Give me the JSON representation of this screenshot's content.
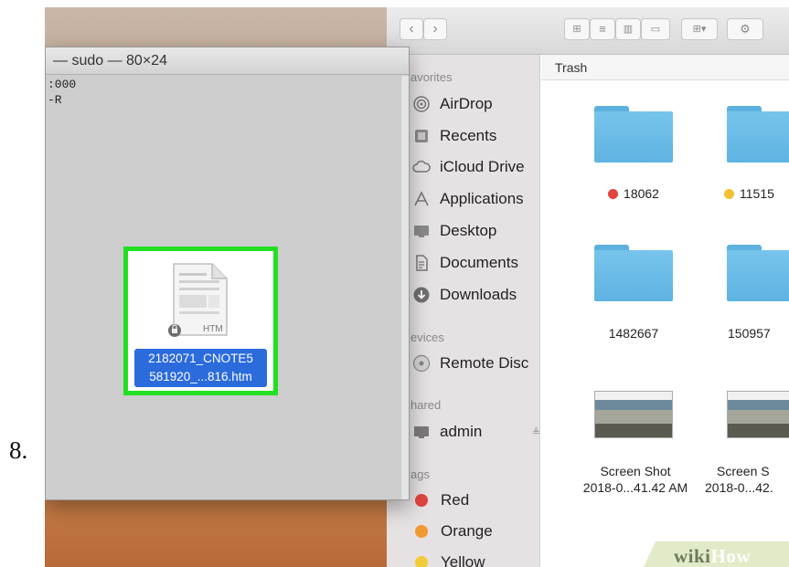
{
  "step_number": "8.",
  "terminal": {
    "title": "— sudo — 80×24",
    "lines": [
      ":000",
      "-R"
    ]
  },
  "file": {
    "icon_label": "HTM",
    "name_line1": "2182071_CNOTE5",
    "name_line2": "581920_...816.htm"
  },
  "finder": {
    "sidebar": {
      "favorites_header": "avorites",
      "favorites": [
        {
          "label": "AirDrop",
          "icon": "airdrop-icon"
        },
        {
          "label": "Recents",
          "icon": "recents-icon"
        },
        {
          "label": "iCloud Drive",
          "icon": "cloud-icon"
        },
        {
          "label": "Applications",
          "icon": "applications-icon"
        },
        {
          "label": "Desktop",
          "icon": "desktop-icon"
        },
        {
          "label": "Documents",
          "icon": "documents-icon"
        },
        {
          "label": "Downloads",
          "icon": "downloads-icon"
        }
      ],
      "devices_header": "evices",
      "devices": [
        {
          "label": "Remote Disc",
          "icon": "disc-icon"
        }
      ],
      "shared_header": "hared",
      "shared": [
        {
          "label": "admin",
          "icon": "monitor-icon",
          "eject": "≜"
        }
      ],
      "tags_header": "ags",
      "tags": [
        {
          "label": "Red",
          "color": "#e2443f"
        },
        {
          "label": "Orange",
          "color": "#ef9a32"
        },
        {
          "label": "Yellow",
          "color": "#f2cc38"
        }
      ]
    },
    "content": {
      "header": "Trash",
      "items": [
        {
          "label": "18062",
          "tag_color": "#e2443f"
        },
        {
          "label": "11515",
          "tag_color": "#f2c032"
        },
        {
          "label": "1482667"
        },
        {
          "label": "150957"
        },
        {
          "label_line1": "Screen Shot",
          "label_line2": "2018-0...41.42 AM"
        },
        {
          "label_line1": "Screen S",
          "label_line2": "2018-0...42."
        }
      ]
    }
  },
  "watermark": {
    "wiki": "wiki",
    "how": "How"
  },
  "colors": {
    "selection_blue": "#2b6bdc",
    "highlight_green": "#21e021",
    "folder_blue": "#6ab9e6"
  }
}
